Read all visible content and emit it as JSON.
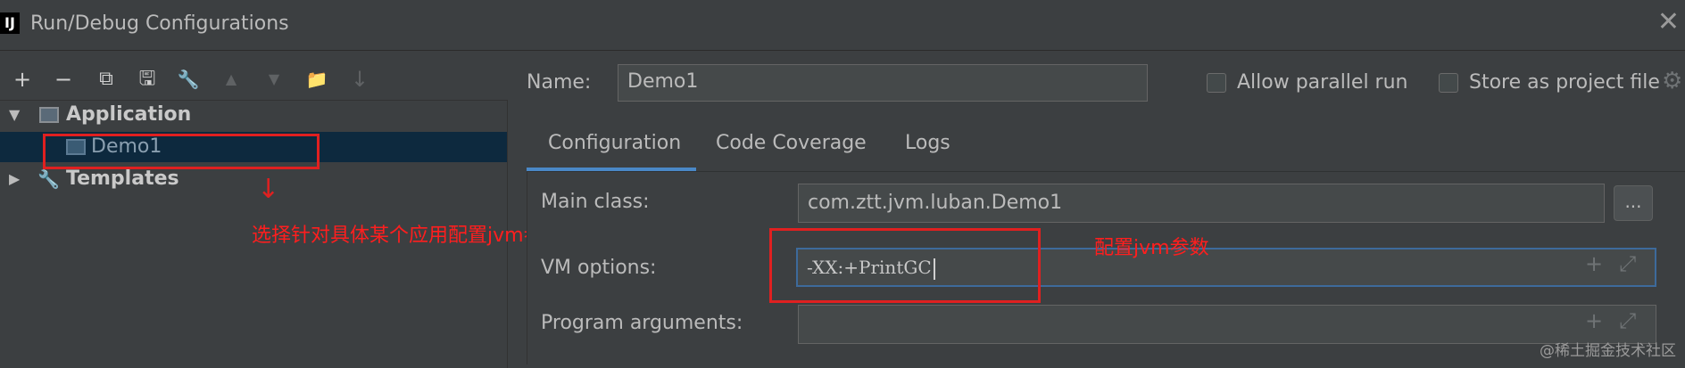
{
  "window": {
    "title": "Run/Debug Configurations",
    "logo_text": "IJ",
    "close_symbol": "✕"
  },
  "toolbar": {
    "icons": [
      {
        "name": "add-icon",
        "glyph": "+",
        "enabled": true
      },
      {
        "name": "remove-icon",
        "glyph": "−",
        "enabled": true
      },
      {
        "name": "copy-icon",
        "glyph": "⧉",
        "enabled": true
      },
      {
        "name": "save-icon",
        "glyph": "🖫",
        "enabled": true
      },
      {
        "name": "wrench-icon",
        "glyph": "🔧",
        "enabled": true
      },
      {
        "name": "move-up-icon",
        "glyph": "▲",
        "enabled": false
      },
      {
        "name": "move-down-icon",
        "glyph": "▼",
        "enabled": false
      },
      {
        "name": "folder-icon",
        "glyph": "📁",
        "enabled": true
      },
      {
        "name": "sort-icon",
        "glyph": "↓",
        "enabled": false
      }
    ]
  },
  "tree": {
    "application_label": "Application",
    "demo_label": "Demo1",
    "templates_label": "Templates",
    "expanded_caret": "▼",
    "collapsed_caret": "▶",
    "wrench_glyph": "🔧"
  },
  "annotations": {
    "left_note": "选择针对具体某个应用配置jvm参数",
    "right_note": "配置jvm参数",
    "arrow": "↓"
  },
  "form": {
    "name_label": "Name:",
    "name_value": "Demo1",
    "allow_parallel_label": "Allow parallel run",
    "store_project_label": "Store as project file",
    "gear_glyph": "⚙",
    "tabs": [
      "Configuration",
      "Code Coverage",
      "Logs"
    ],
    "main_class_label": "Main class:",
    "main_class_value": "com.ztt.jvm.luban.Demo1",
    "browse_label": "...",
    "vm_options_label": "VM options:",
    "vm_options_value": "-XX:+PrintGC",
    "program_args_label": "Program arguments:",
    "program_args_value": "",
    "plus_glyph": "+",
    "expand_glyph": "⤢"
  },
  "watermark": "@稀土掘金技术社区",
  "colors": {
    "background": "#3c3f41",
    "selection": "#0d293e",
    "accent": "#4a88c7",
    "annotation": "#e02020"
  }
}
